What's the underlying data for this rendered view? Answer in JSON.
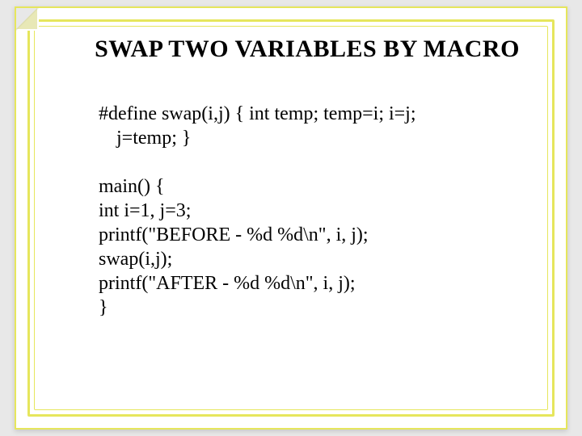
{
  "title": "SWAP TWO VARIABLES BY MACRO",
  "macro": {
    "line1": "#define swap(i,j) { int temp; temp=i; i=j;",
    "line2": "j=temp; }"
  },
  "code": {
    "l1": "main() {",
    "l2": "int i=1, j=3;",
    "l3": "printf(\"BEFORE - %d %d\\n\", i, j);",
    "l4": "swap(i,j);",
    "l5": "printf(\"AFTER - %d %d\\n\", i, j);",
    "l6": "}"
  }
}
